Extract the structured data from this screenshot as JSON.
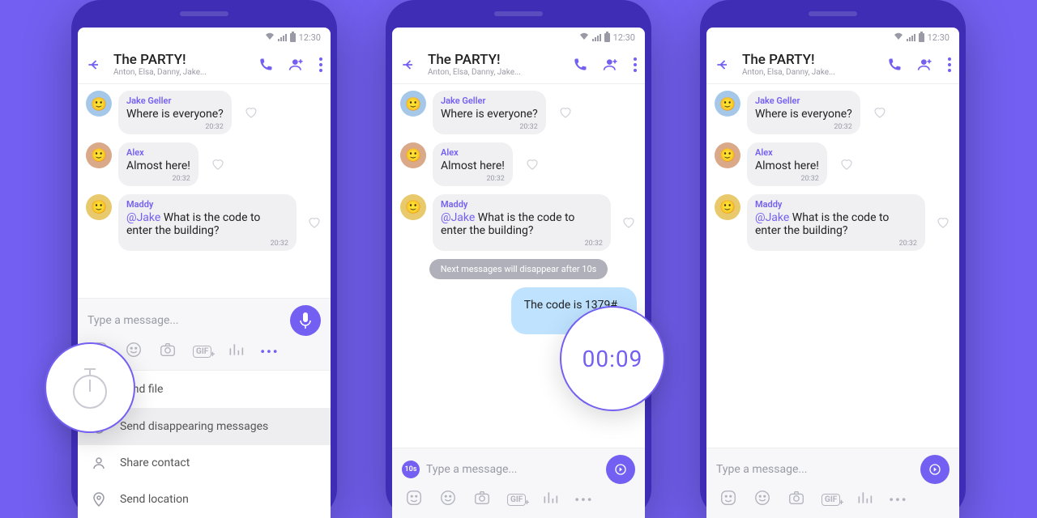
{
  "status": {
    "time": "12:30"
  },
  "header": {
    "title": "The PARTY!",
    "subtitle": "Anton, Elsa, Danny, Jake..."
  },
  "messages": [
    {
      "sender": "Jake Geller",
      "text": "Where is everyone?",
      "time": "20:32"
    },
    {
      "sender": "Alex",
      "text": "Almost here!",
      "time": "20:32"
    },
    {
      "sender": "Maddy",
      "mention": "@Jake",
      "text": " What is the code to enter the building?",
      "time": "20:32"
    }
  ],
  "system_notice": "Next messages will disappear after 10s",
  "outgoing": {
    "text": "The code is 1379#"
  },
  "input": {
    "placeholder": "Type a message..."
  },
  "timer_chip": "10s",
  "countdown": "00:09",
  "sheet": {
    "send_file": "Send file",
    "send_disappearing": "Send disappearing messages",
    "share_contact": "Share contact",
    "send_location": "Send location"
  }
}
